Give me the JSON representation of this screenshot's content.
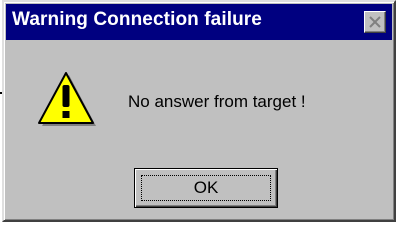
{
  "window": {
    "title": "Warning Connection failure",
    "close_icon": "close-icon"
  },
  "dialog": {
    "icon": "warning-icon",
    "message": "No answer from target !",
    "ok_label": "OK"
  },
  "colors": {
    "titlebar": "#000080",
    "face": "#c0c0c0",
    "warning_yellow": "#ffff00"
  }
}
